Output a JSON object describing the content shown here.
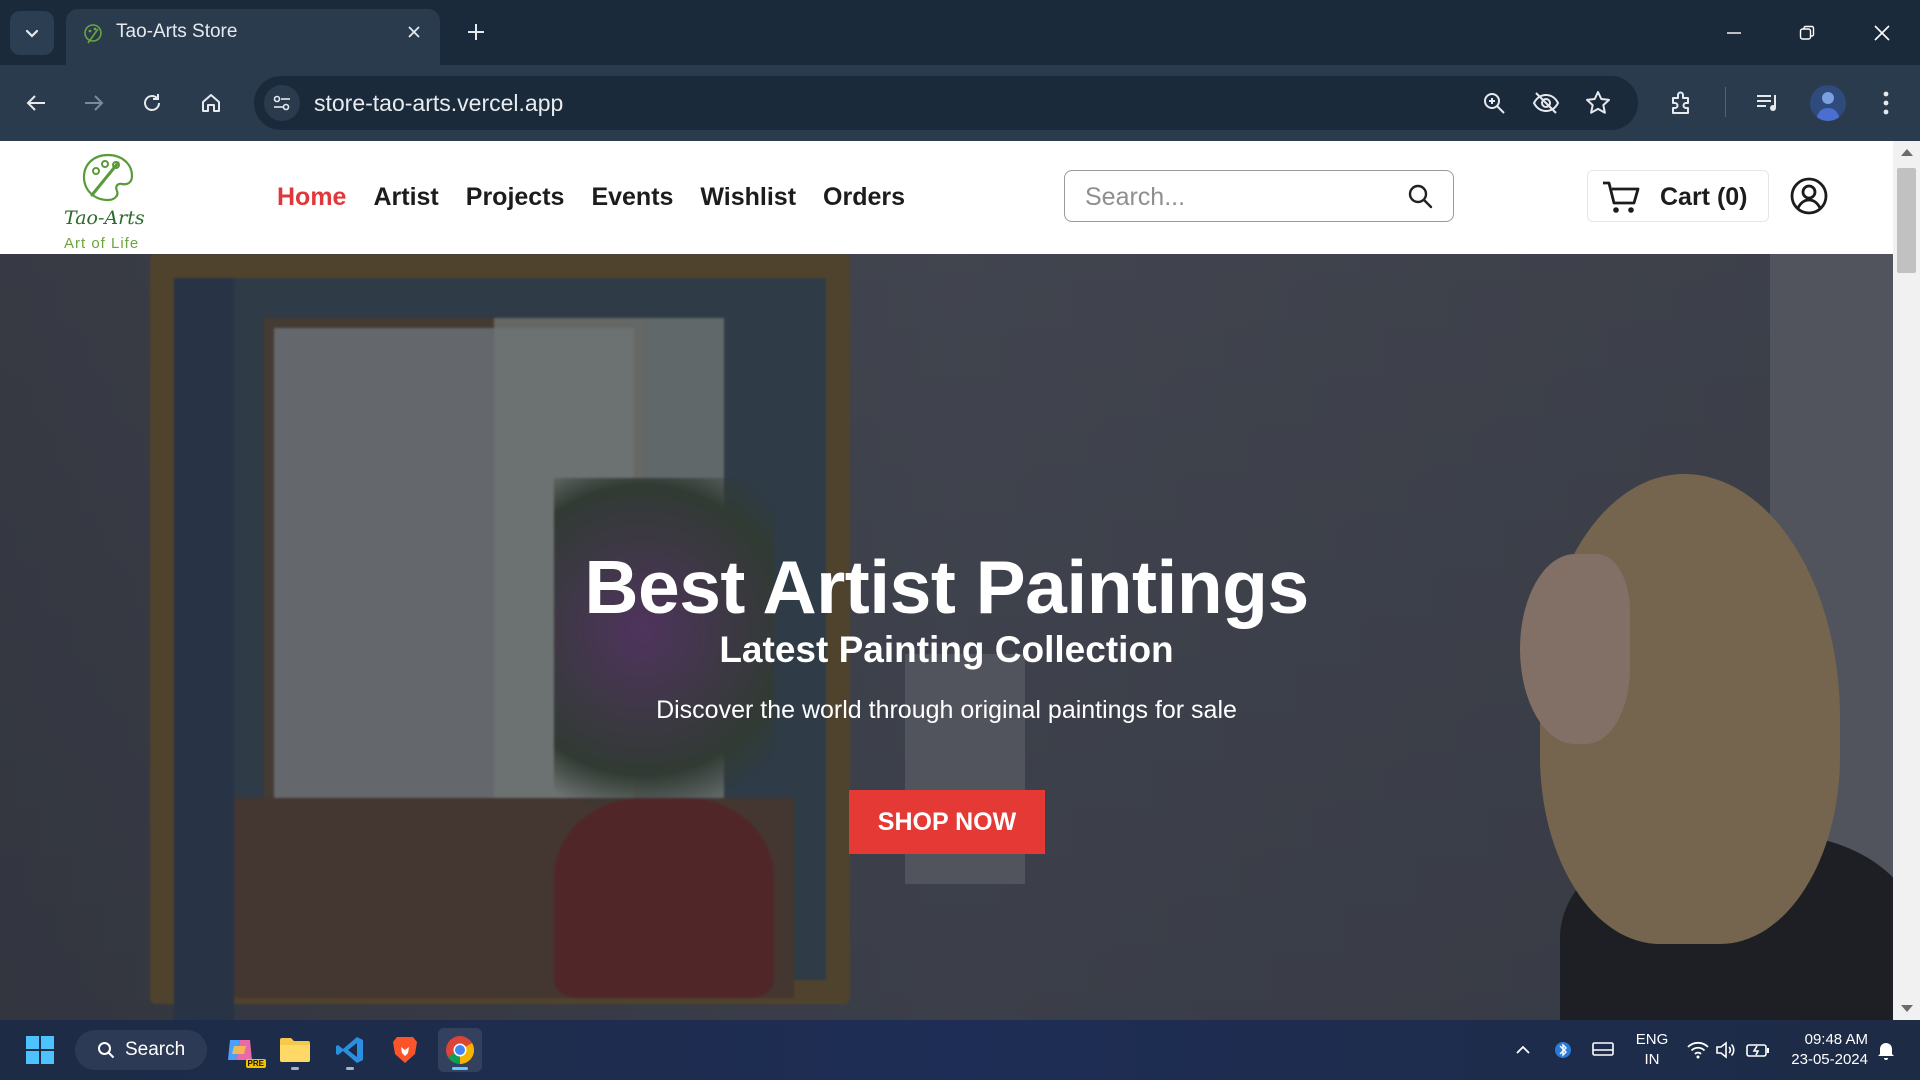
{
  "browser": {
    "tab_title": "Tao-Arts Store",
    "url": "store-tao-arts.vercel.app"
  },
  "site": {
    "logo": {
      "brand": "Tao-Arts",
      "tagline": "Art of Life"
    },
    "nav": [
      {
        "label": "Home",
        "active": true
      },
      {
        "label": "Artist"
      },
      {
        "label": "Projects"
      },
      {
        "label": "Events"
      },
      {
        "label": "Wishlist"
      },
      {
        "label": "Orders"
      }
    ],
    "search": {
      "placeholder": "Search..."
    },
    "cart": {
      "label": "Cart (0)"
    },
    "accent_color": "#e53935"
  },
  "hero": {
    "title": "Best Artist Paintings",
    "subtitle": "Latest Painting Collection",
    "description": "Discover the world through original paintings for sale",
    "cta": "SHOP NOW"
  },
  "taskbar": {
    "search_label": "Search",
    "language": {
      "line1": "ENG",
      "line2": "IN"
    },
    "time": "09:48 AM",
    "date": "23-05-2024",
    "copilot_badge": "PRE"
  }
}
